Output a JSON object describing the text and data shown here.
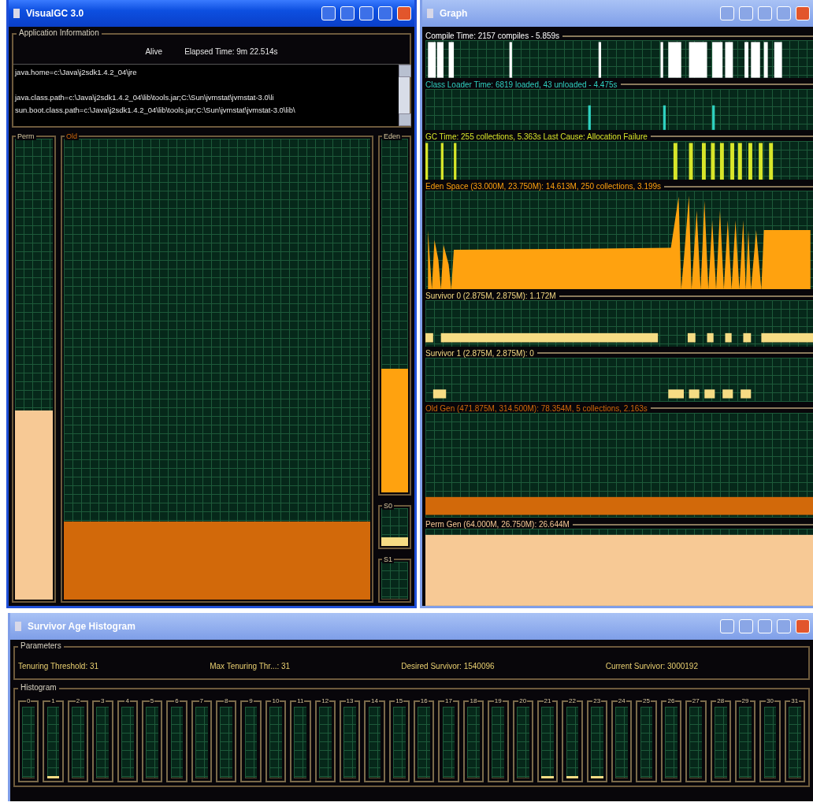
{
  "main_window": {
    "title": "VisualGC 3.0",
    "app_info": {
      "heading": "Application Information",
      "status": "Alive",
      "elapsed": "Elapsed Time:  9m 22.514s",
      "properties": [
        "java.home=c:\\Java\\j2sdk1.4.2_04\\jre",
        "java.class.path=c:\\Java\\j2sdk1.4.2_04\\lib\\tools.jar;C:\\Sun\\jvmstat\\jvmstat-3.0\\li",
        "sun.boot.class.path=c:\\Java\\j2sdk1.4.2_04\\lib\\tools.jar;C:\\Sun\\jvmstat\\jvmstat-3.0\\lib\\"
      ]
    },
    "spaces": [
      {
        "name": "Perm",
        "kind": "side",
        "level": 0.41,
        "color": "#f7c995"
      },
      {
        "name": "Old",
        "kind": "main",
        "level": 0.17,
        "color": "#d2690a"
      },
      {
        "name": "Eden",
        "kind": "stack",
        "level": 0.35,
        "color": "#ffa20f"
      },
      {
        "name": "S0",
        "kind": "stack",
        "level": 0.22,
        "color": "#f6dc84"
      },
      {
        "name": "S1",
        "kind": "stack",
        "level": 0
      }
    ]
  },
  "graph_window": {
    "title": "Graph",
    "graphs": [
      {
        "label": "Compile Time: 2157 compiles - 5.859s",
        "kind": "spikes",
        "color": "#ffffff"
      },
      {
        "label": "Class Loader Time: 6819 loaded, 43 unloaded - 4.475s",
        "kind": "spikes",
        "color": "#2fd1c0"
      },
      {
        "label": "GC Time: 255 collections, 5.363s  Last Cause: Allocation Failure",
        "kind": "spikes",
        "color": "#d8e62a"
      },
      {
        "label": "Eden Space (33.000M, 23.750M): 14.613M, 250 collections, 3.199s",
        "kind": "area",
        "color": "#ffa20f"
      },
      {
        "label": "Survivor 0 (2.875M, 2.875M): 1.172M",
        "kind": "steps",
        "color": "#f6dc84"
      },
      {
        "label": "Survivor 1 (2.875M, 2.875M): 0",
        "kind": "steps",
        "color": "#f6dc84"
      },
      {
        "label": "Old Gen (471.875M, 314.500M): 78.354M, 5 collections, 2.163s",
        "kind": "band",
        "color": "#d2690a"
      },
      {
        "label": "Perm Gen (64.000M, 26.750M): 26.644M",
        "kind": "full",
        "color": "#f7c995"
      }
    ]
  },
  "histogram_window": {
    "title": "Survivor Age Histogram",
    "parameters": {
      "heading": "Parameters",
      "items": [
        "Tenuring Threshold: 31",
        "Max Tenuring Thr...: 31",
        "Desired Survivor: 1540096",
        "Current Survivor: 3000192"
      ]
    },
    "histogram": {
      "heading": "Histogram",
      "bins": [
        {
          "label": "0",
          "level": 0
        },
        {
          "label": "1",
          "level": 0.03
        },
        {
          "label": "2",
          "level": 0
        },
        {
          "label": "3",
          "level": 0
        },
        {
          "label": "4",
          "level": 0
        },
        {
          "label": "5",
          "level": 0
        },
        {
          "label": "6",
          "level": 0
        },
        {
          "label": "7",
          "level": 0
        },
        {
          "label": "8",
          "level": 0
        },
        {
          "label": "9",
          "level": 0
        },
        {
          "label": "10",
          "level": 0
        },
        {
          "label": "11",
          "level": 0
        },
        {
          "label": "12",
          "level": 0
        },
        {
          "label": "13",
          "level": 0
        },
        {
          "label": "14",
          "level": 0
        },
        {
          "label": "15",
          "level": 0
        },
        {
          "label": "16",
          "level": 0
        },
        {
          "label": "17",
          "level": 0
        },
        {
          "label": "18",
          "level": 0
        },
        {
          "label": "19",
          "level": 0
        },
        {
          "label": "20",
          "level": 0
        },
        {
          "label": "21",
          "level": 0.03
        },
        {
          "label": "22",
          "level": 0.03
        },
        {
          "label": "23",
          "level": 0.03
        },
        {
          "label": "24",
          "level": 0
        },
        {
          "label": "25",
          "level": 0
        },
        {
          "label": "26",
          "level": 0
        },
        {
          "label": "27",
          "level": 0
        },
        {
          "label": "28",
          "level": 0
        },
        {
          "label": "29",
          "level": 0
        },
        {
          "label": "30",
          "level": 0
        },
        {
          "label": "31",
          "level": 0
        }
      ]
    }
  }
}
